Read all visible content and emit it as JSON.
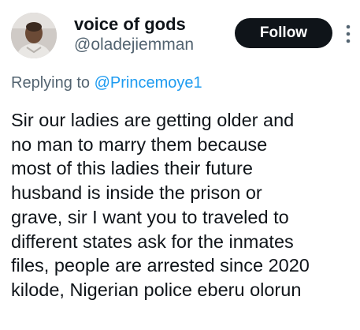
{
  "author": {
    "display_name": "voice of gods",
    "handle": "@oladejiemman"
  },
  "follow_button": {
    "label": "Follow"
  },
  "more_menu": {
    "icon": "more-vertical-icon"
  },
  "reply_context": {
    "prefix": "Replying to",
    "mention": "@Princemoye1"
  },
  "tweet": {
    "lines": [
      "Sir our ladies are getting older and",
      "no man to marry them because",
      "most of this ladies their future",
      "husband is inside the prison or",
      "grave, sir I want you to traveled to",
      "different states ask for the inmates",
      "files, people are arrested since 2020",
      "kilode, Nigerian police eberu olorun"
    ]
  },
  "colors": {
    "text_primary": "#0f1419",
    "text_secondary": "#536471",
    "link": "#1d9bf0",
    "button_bg": "#0f1419",
    "button_text": "#ffffff"
  }
}
